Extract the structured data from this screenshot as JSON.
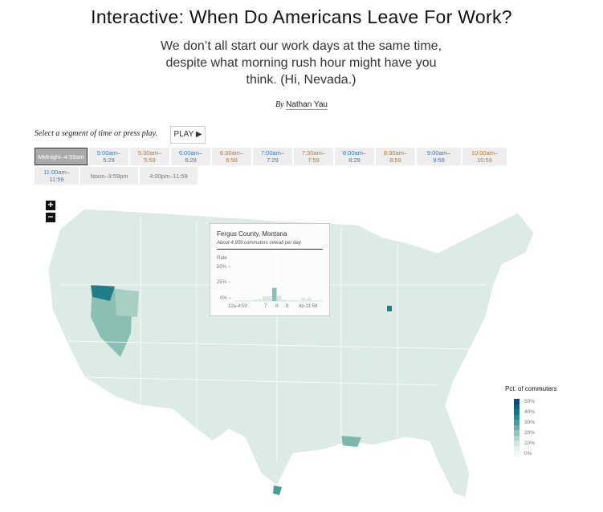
{
  "title": "Interactive: When Do Americans Leave For Work?",
  "subtitle": "We don’t all start our work days at the same time, despite what morning rush hour might have you think. (Hi, Nevada.)",
  "byline": {
    "by": "By",
    "author": "Nathan Yau"
  },
  "controls": {
    "instruction": "Select a segment of time or press play.",
    "play_label": "PLAY ▶"
  },
  "segments": [
    {
      "label": "Midnight–4:59am",
      "selected": true
    },
    {
      "label": "5:00am–\n5:29"
    },
    {
      "label": "5:30am–\n5:59"
    },
    {
      "label": "6:00am–\n6:29"
    },
    {
      "label": "6:30am–\n6:59"
    },
    {
      "label": "7:00am–\n7:29"
    },
    {
      "label": "7:30am–\n7:59"
    },
    {
      "label": "8:00am–\n8:29"
    },
    {
      "label": "8:30am–\n8:59"
    },
    {
      "label": "9:00am–\n9:59"
    },
    {
      "label": "10:00am–\n10:59"
    },
    {
      "label": "11:00am–\n11:59"
    },
    {
      "label": "Noon–3:59pm"
    },
    {
      "label": "4:00pm–11:59"
    }
  ],
  "zoom": {
    "in": "+",
    "out": "−"
  },
  "tooltip": {
    "county": "Fergus County, Montana",
    "commuters": "About 4,959 commuters overall per day",
    "rate_label": "Rate",
    "y_ticks": [
      "50% –",
      "25% –",
      "0% –"
    ],
    "x_ticks": [
      "12a-4:59",
      "7",
      "8",
      "9",
      "4p-11:59"
    ],
    "rates_pct": [
      1,
      1,
      2,
      3,
      8,
      8,
      22,
      9,
      2,
      1,
      1,
      5,
      5
    ],
    "highlight_index": 6
  },
  "legend": {
    "title": "Pct. of commuters",
    "items": [
      {
        "label": "50%",
        "color": "#08497a"
      },
      {
        "label": "",
        "color": "#0d5f82"
      },
      {
        "label": "40%",
        "color": "#137585"
      },
      {
        "label": "",
        "color": "#2a8a8a"
      },
      {
        "label": "30%",
        "color": "#4a9c98"
      },
      {
        "label": "",
        "color": "#6eb0a8"
      },
      {
        "label": "20%",
        "color": "#92c4ba"
      },
      {
        "label": "",
        "color": "#b3d6cc"
      },
      {
        "label": "10%",
        "color": "#cfe5dd"
      },
      {
        "label": "",
        "color": "#e4f0ec"
      },
      {
        "label": "0%",
        "color": ""
      }
    ]
  }
}
